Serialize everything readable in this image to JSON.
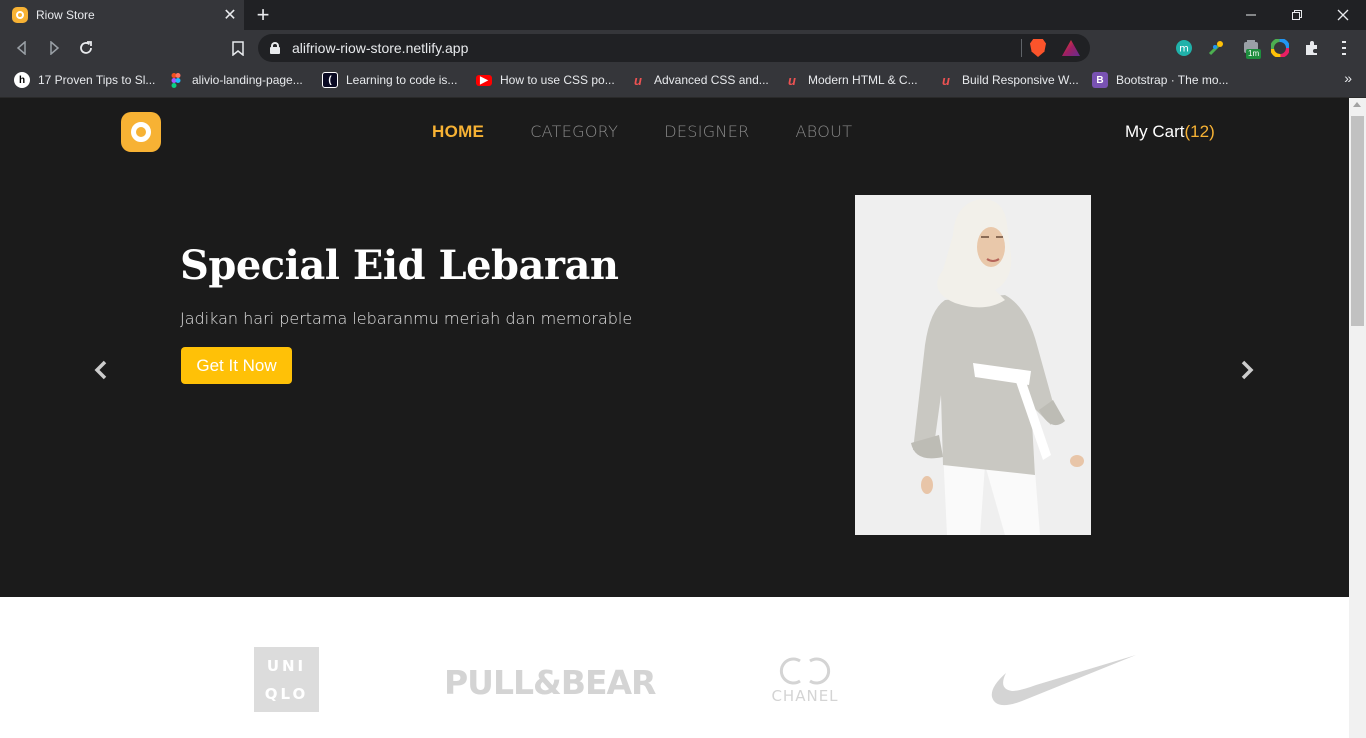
{
  "browser": {
    "tab_title": "Riow Store",
    "url": "alifriow-riow-store.netlify.app",
    "extension_badge": "1m",
    "bookmarks": [
      {
        "label": "17 Proven Tips to Sl...",
        "icon": "hashnode-icon",
        "color": "#2962ff"
      },
      {
        "label": "alivio-landing-page...",
        "icon": "figma-icon",
        "color": "#f24e1e"
      },
      {
        "label": "Learning to code is...",
        "icon": "freecodecamp-icon",
        "color": "#0a0a23"
      },
      {
        "label": "How to use CSS po...",
        "icon": "youtube-icon",
        "color": "#ff0000"
      },
      {
        "label": "Advanced CSS and...",
        "icon": "udemy-icon",
        "color": "#ec5252"
      },
      {
        "label": "Modern HTML & C...",
        "icon": "udemy-icon",
        "color": "#ec5252"
      },
      {
        "label": "Build Responsive W...",
        "icon": "udemy-icon",
        "color": "#ec5252"
      },
      {
        "label": "Bootstrap · The mo...",
        "icon": "bootstrap-icon",
        "color": "#7952b3"
      }
    ]
  },
  "site": {
    "nav": [
      {
        "label": "HOME",
        "active": true
      },
      {
        "label": "CATEGORY",
        "active": false
      },
      {
        "label": "DESIGNER",
        "active": false
      },
      {
        "label": "ABOUT",
        "active": false
      }
    ],
    "cart_label": "My Cart",
    "cart_open": "(",
    "cart_count": "12",
    "cart_close": ")",
    "accent_color": "#f7b234",
    "button_color": "#ffc107"
  },
  "hero": {
    "title": "Special Eid Lebaran",
    "subtitle": "Jadikan hari pertama lebaranmu meriah dan memorable",
    "cta": "Get It Now"
  },
  "brands": {
    "uniqlo": [
      "UNI",
      "QLO"
    ],
    "pullbear": "PULL&BEAR",
    "chanel": "CHANEL",
    "nike": "nike-swoosh"
  }
}
